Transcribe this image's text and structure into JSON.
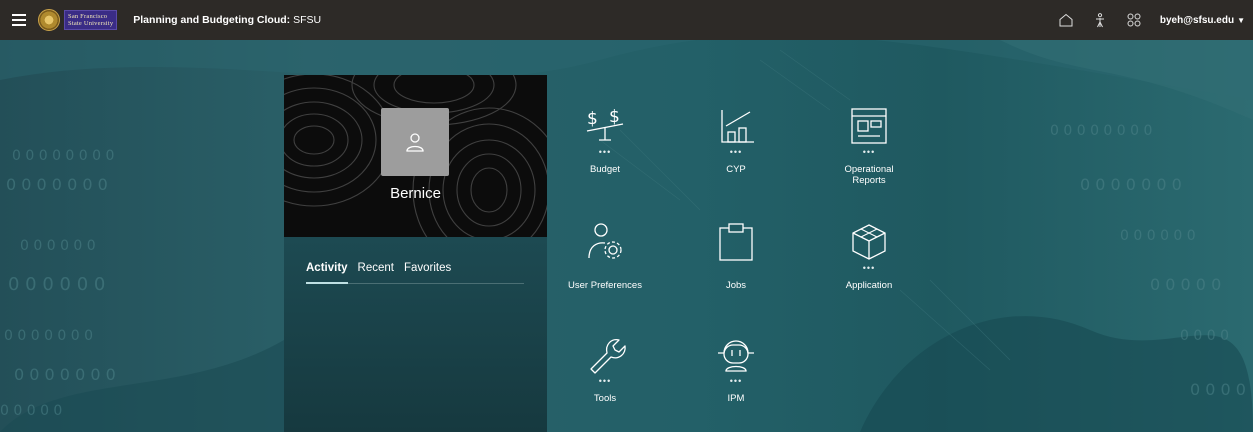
{
  "header": {
    "org_line1": "San Francisco",
    "org_line2": "State University",
    "app_title_bold": "Planning and Budgeting Cloud:",
    "app_title_rest": " SFSU",
    "user": "byeh@sfsu.edu",
    "icons": [
      "menu-icon",
      "home-icon",
      "navigator-icon",
      "grid-icon",
      "caret-down-icon"
    ]
  },
  "profile": {
    "name": "Bernice",
    "tabs": [
      "Activity",
      "Recent",
      "Favorites"
    ],
    "active_tab": "Activity"
  },
  "tiles": [
    {
      "label": "Budget",
      "icon": "budget-icon",
      "has_dots": true
    },
    {
      "label": "CYP",
      "icon": "chart-icon",
      "has_dots": true
    },
    {
      "label": "Operational Reports",
      "icon": "reports-icon",
      "has_dots": true
    },
    {
      "label": "User Preferences",
      "icon": "user-gear-icon",
      "has_dots": false
    },
    {
      "label": "Jobs",
      "icon": "clipboard-icon",
      "has_dots": false
    },
    {
      "label": "Application",
      "icon": "cube-icon",
      "has_dots": true
    },
    {
      "label": "Tools",
      "icon": "wrench-icon",
      "has_dots": true
    },
    {
      "label": "IPM",
      "icon": "robot-icon",
      "has_dots": true
    }
  ],
  "colors": {
    "topbar": "#2d2a27",
    "background": "#1e4f57",
    "panel_header": "#0c0c0c",
    "tab_indicator": "#bfe0e3"
  }
}
